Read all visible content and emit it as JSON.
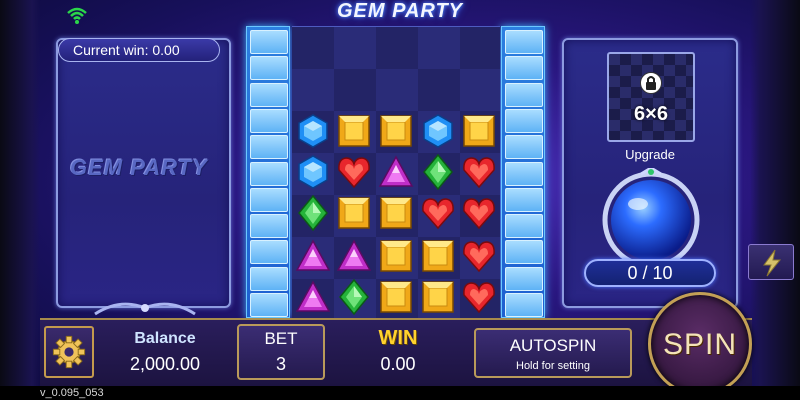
{
  "game": {
    "title": "GEM PARTY",
    "logo_text": "GEM PARTY"
  },
  "left_panel": {
    "current_win": "Current win: 0.00"
  },
  "reels": {
    "rows": [
      [
        "",
        "",
        "",
        "",
        ""
      ],
      [
        "blue-hexagon-gem",
        "gold-square-gem",
        "gold-square-gem",
        "blue-hexagon-gem",
        "gold-square-gem"
      ],
      [
        "blue-hexagon-gem",
        "red-heart-gem",
        "purple-triangle-gem",
        "green-diamond-gem",
        "red-heart-gem"
      ],
      [
        "green-diamond-gem",
        "gold-square-gem",
        "gold-square-gem",
        "red-heart-gem",
        "red-heart-gem"
      ],
      [
        "purple-triangle-gem",
        "purple-triangle-gem",
        "gold-square-gem",
        "gold-square-gem",
        "red-heart-gem"
      ],
      [
        "purple-triangle-gem",
        "green-diamond-gem",
        "gold-square-gem",
        "gold-square-gem",
        "red-heart-gem"
      ]
    ]
  },
  "right_panel": {
    "grid_size": "6×6",
    "upgrade_label": "Upgrade",
    "progress": "0 / 10",
    "lock_icon": "lock-icon",
    "turbo_icon": "lightning-icon"
  },
  "bottom_bar": {
    "settings_icon": "gear-icon",
    "balance_label": "Balance",
    "balance_value": "2,000.00",
    "bet_label": "BET",
    "bet_value": "3",
    "win_label": "WIN",
    "win_value": "0.00",
    "autospin_label": "AUTOSPIN",
    "autospin_sub": "Hold for setting",
    "spin_label": "SPIN"
  },
  "status": {
    "version": "v_0.095_053",
    "wifi_icon": "wifi-icon"
  },
  "colors": {
    "accent_gold": "#c3a055",
    "win_yellow": "#ffd22e",
    "reel_blue": "#2c7fe0",
    "panel_border": "#8d9be0"
  }
}
